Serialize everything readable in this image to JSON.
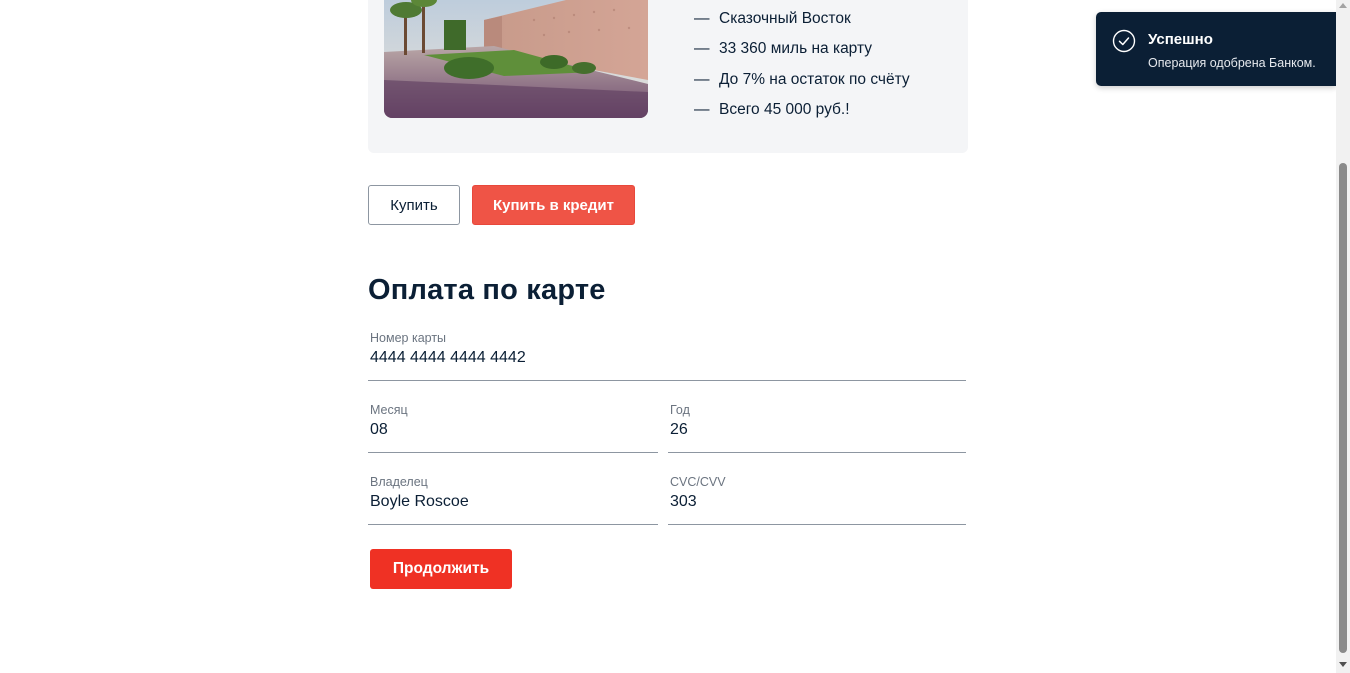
{
  "offer": {
    "features": [
      "Сказочный Восток",
      "33 360 миль на карту",
      "До 7% на остаток по счёту",
      "Всего 45 000 руб.!"
    ],
    "dash": "—"
  },
  "actions": {
    "buy_label": "Купить",
    "credit_label": "Купить в кредит"
  },
  "payment": {
    "title": "Оплата по карте",
    "card_number": {
      "label": "Номер карты",
      "value": "4444 4444 4444 4442"
    },
    "month": {
      "label": "Месяц",
      "value": "08"
    },
    "year": {
      "label": "Год",
      "value": "26"
    },
    "owner": {
      "label": "Владелец",
      "value": "Boyle Roscoe"
    },
    "cvc": {
      "label": "CVC/CVV",
      "value": "303"
    },
    "continue_label": "Продолжить"
  },
  "notification": {
    "title": "Успешно",
    "message": "Операция одобрена Банком.",
    "icon": "check-circle-icon"
  },
  "colors": {
    "accent": "#ef3124",
    "dark": "#0b1f35",
    "card_bg": "#f4f5f7"
  }
}
